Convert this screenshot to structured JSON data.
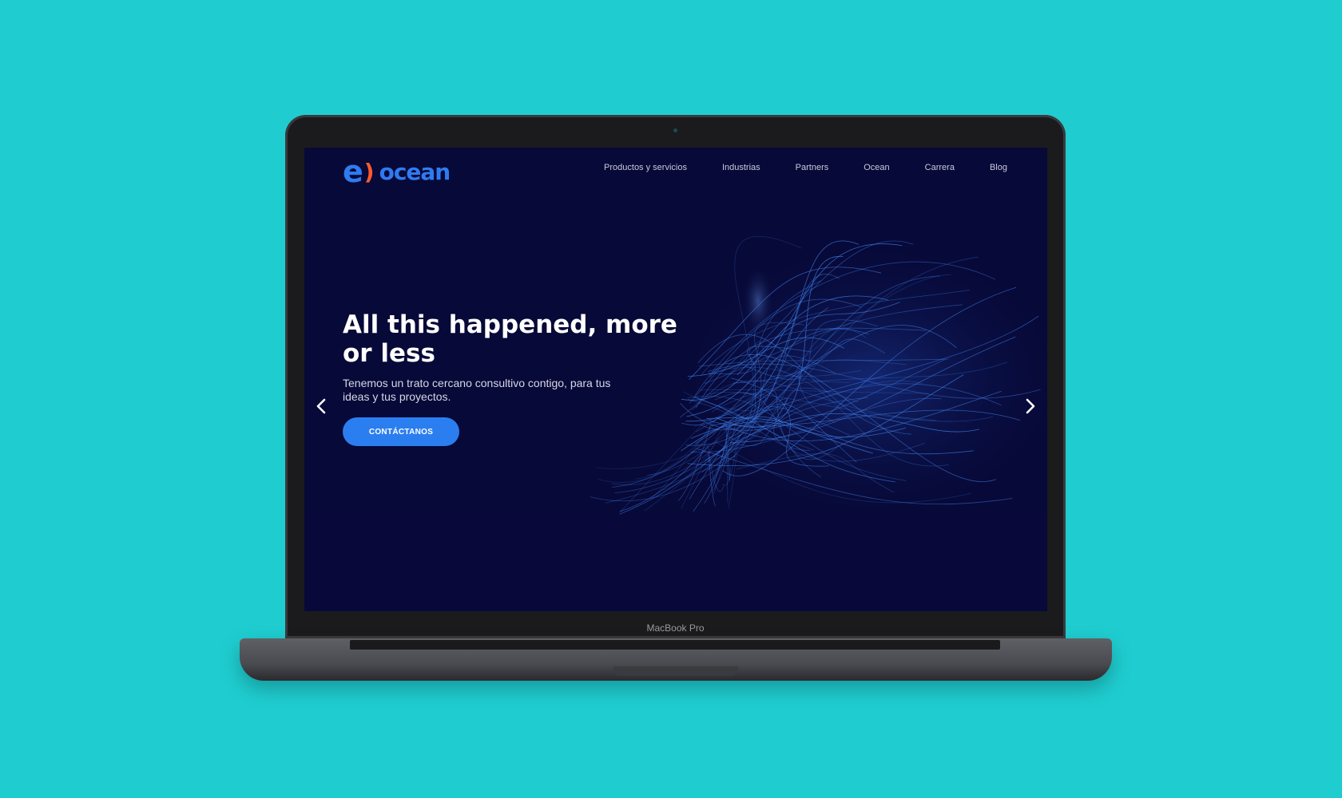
{
  "device": {
    "label": "MacBook Pro"
  },
  "site": {
    "logo": {
      "mark": "e",
      "bracket": ")",
      "word": "ocean",
      "mark_color": "#2f7bf0",
      "bracket_color": "#ff5a2d"
    },
    "nav": {
      "items": [
        {
          "label": "Productos y servicios"
        },
        {
          "label": "Industrias"
        },
        {
          "label": "Partners"
        },
        {
          "label": "Ocean"
        },
        {
          "label": "Carrera"
        },
        {
          "label": "Blog"
        }
      ]
    },
    "hero": {
      "title": "All this happened, more or less",
      "subtitle": "Tenemos un trato cercano consultivo contigo, para tus ideas y tus proyectos.",
      "cta_label": "CONTÁCTANOS",
      "prev_icon": "chevron-left-icon",
      "next_icon": "chevron-right-icon"
    }
  },
  "colors": {
    "background": "#1fcdd0",
    "screen_bg": "#070938",
    "accent": "#2b7ef0"
  }
}
